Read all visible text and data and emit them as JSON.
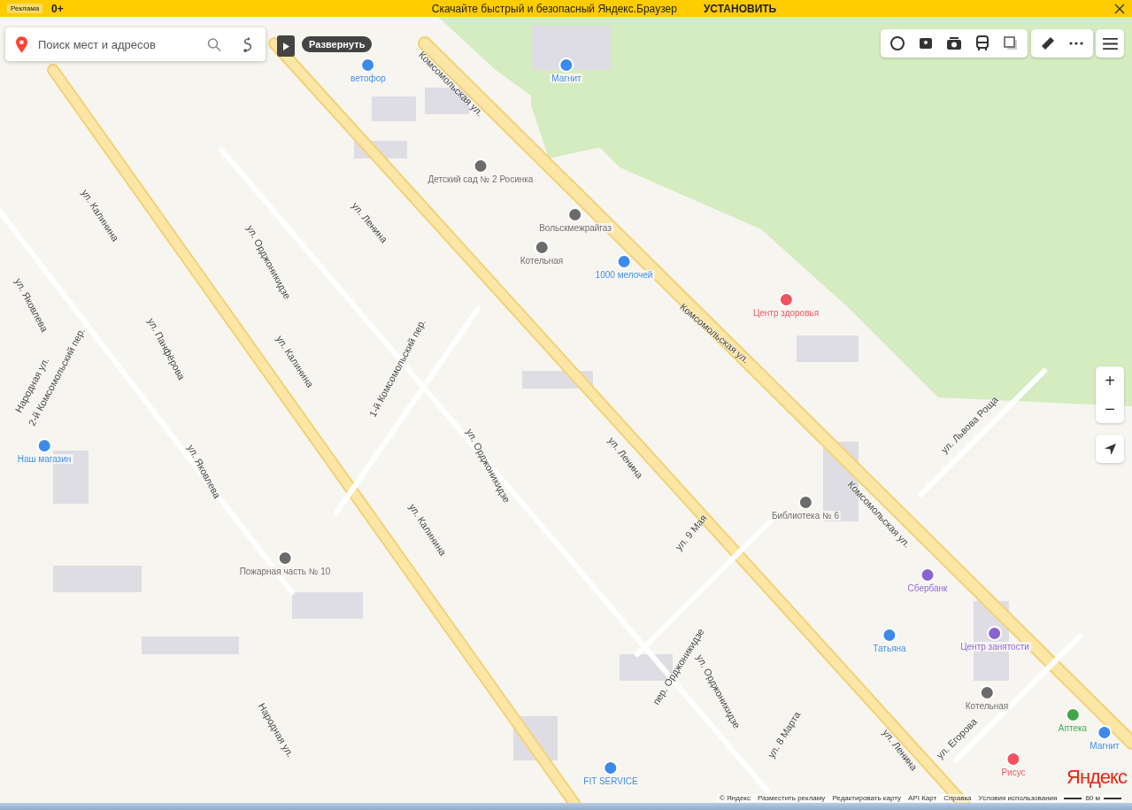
{
  "top_banner": {
    "ad_label": "Реклама",
    "age": "0+",
    "text": "Скачайте быстрый и безопасный Яндекс.Браузер",
    "action": "УСТАНОВИТЬ"
  },
  "search": {
    "placeholder": "Поиск мест и адресов"
  },
  "expand_button": {
    "label": "Развернуть"
  },
  "map": {
    "streets": [
      {
        "name": "Комсомольская ул."
      },
      {
        "name": "Комсомольская ул."
      },
      {
        "name": "Комсомольская ул."
      },
      {
        "name": "ул. Ленина"
      },
      {
        "name": "ул. Ленина"
      },
      {
        "name": "ул. Ленина"
      },
      {
        "name": "ул. Калинина"
      },
      {
        "name": "ул. Калинина"
      },
      {
        "name": "ул. Калинина"
      },
      {
        "name": "ул. Орджоникидзе"
      },
      {
        "name": "ул. Орджоникидзе"
      },
      {
        "name": "ул. Орджоникидзе"
      },
      {
        "name": "1-й Комсомольский пер."
      },
      {
        "name": "ул. Яковлева"
      },
      {
        "name": "ул. Яковлева"
      },
      {
        "name": "ул. Панфёрова"
      },
      {
        "name": "Народная ул."
      },
      {
        "name": "2-й Комсомольский пер."
      },
      {
        "name": "ул. 9 Мая"
      },
      {
        "name": "ул. 8 Марта"
      },
      {
        "name": "пер. Орджоникидзе"
      },
      {
        "name": "ул. Львова Роща"
      },
      {
        "name": "ул. Егорова"
      },
      {
        "name": "Народная ул."
      }
    ],
    "pois": [
      {
        "name": "ветофор",
        "color": "#3d8be8"
      },
      {
        "name": "Магнит",
        "color": "#3d8be8"
      },
      {
        "name": "Детский сад № 2 Росинка",
        "color": "#6b6b6b"
      },
      {
        "name": "Вольскмежрайгаз",
        "color": "#6b6b6b"
      },
      {
        "name": "Котельная",
        "color": "#6b6b6b"
      },
      {
        "name": "1000 мелочей",
        "color": "#3d8be8"
      },
      {
        "name": "Центр здоровья",
        "color": "#f0535f"
      },
      {
        "name": "Библиотека № 6",
        "color": "#6b6b6b"
      },
      {
        "name": "Наш магазин",
        "color": "#3d8be8"
      },
      {
        "name": "Пожарная часть № 10",
        "color": "#6b6b6b"
      },
      {
        "name": "Сбербанк",
        "color": "#8a63d2"
      },
      {
        "name": "Татьяна",
        "color": "#3d8be8"
      },
      {
        "name": "Центр занятости",
        "color": "#8a63d2"
      },
      {
        "name": "Котельная",
        "color": "#6b6b6b"
      },
      {
        "name": "Аптека",
        "color": "#3fa64a"
      },
      {
        "name": "Магнит",
        "color": "#3d8be8"
      },
      {
        "name": "Рисус",
        "color": "#f0535f"
      },
      {
        "name": "FIT SERVICE",
        "color": "#3d8be8"
      }
    ]
  },
  "zoom": {
    "plus": "+",
    "minus": "−"
  },
  "attribution": [
    "© Яндекс",
    "Разместить рекламу",
    "Редактировать карту",
    "API Карт",
    "Справка",
    "Условия использования"
  ],
  "logo": "Яндекс",
  "scale": "60 м"
}
